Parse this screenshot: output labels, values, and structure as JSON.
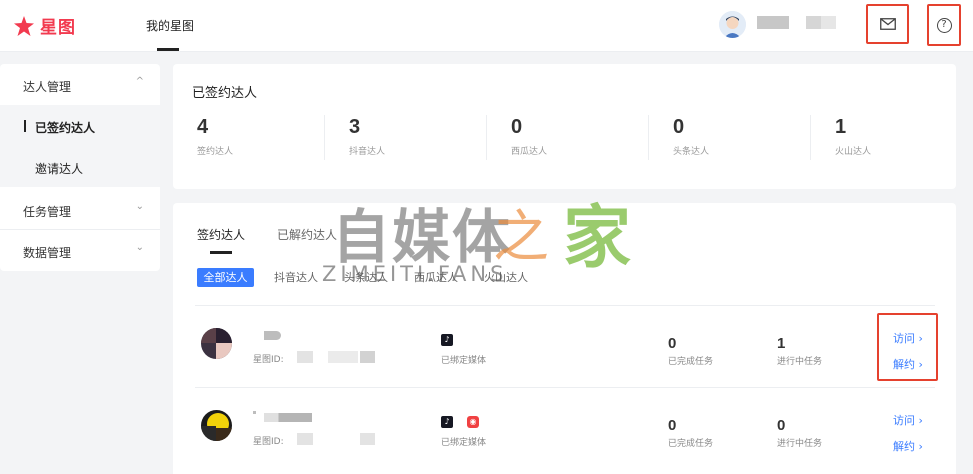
{
  "header": {
    "logo_text": "星图",
    "nav_tab": "我的星图",
    "mail_icon": "mail-icon",
    "help_icon": "help-icon",
    "help_glyph": "?"
  },
  "sidebar": {
    "groups": [
      {
        "label": "达人管理",
        "chevron": "^"
      },
      {
        "label": "任务管理",
        "chevron": "⌄"
      },
      {
        "label": "数据管理",
        "chevron": "⌄"
      }
    ],
    "sub_items": [
      {
        "label": "已签约达人",
        "active": true
      },
      {
        "label": "邀请达人",
        "active": false
      }
    ]
  },
  "stats": {
    "title": "已签约达人",
    "items": [
      {
        "value": "4",
        "label": "签约达人"
      },
      {
        "value": "3",
        "label": "抖音达人"
      },
      {
        "value": "0",
        "label": "西瓜达人"
      },
      {
        "value": "0",
        "label": "头条达人"
      },
      {
        "value": "1",
        "label": "火山达人"
      }
    ]
  },
  "list": {
    "tabs": [
      "签约达人",
      "已解约达人"
    ],
    "filters": [
      "全部达人",
      "抖音达人",
      "头条达人",
      "西瓜达人",
      "火山达人"
    ],
    "rows": [
      {
        "id_label": "星图ID:",
        "media_label": "已绑定媒体",
        "completed_value": "0",
        "completed_label": "已完成任务",
        "in_progress_value": "1",
        "in_progress_label": "进行中任务",
        "visit": "访问 ›",
        "terminate": "解约 ›"
      },
      {
        "id_label": "星图ID:",
        "media_label": "已绑定媒体",
        "completed_value": "0",
        "completed_label": "已完成任务",
        "in_progress_value": "0",
        "in_progress_label": "进行中任务",
        "visit": "访问 ›",
        "terminate": "解约 ›"
      }
    ]
  },
  "watermark": {
    "cn_main": "自媒体",
    "cn_zhi": "之",
    "cn_jia": "家",
    "en": "ZIMEITI.FANS"
  },
  "colors": {
    "accent": "#3a7cff",
    "brand": "#f23a4f",
    "highlight": "#e5412e"
  }
}
